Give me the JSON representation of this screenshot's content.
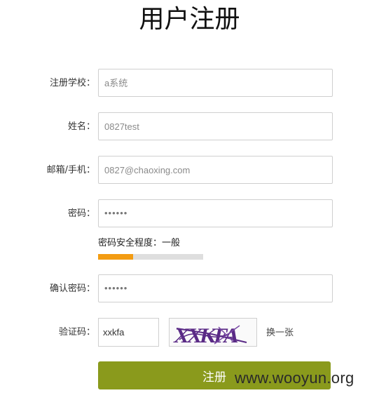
{
  "page": {
    "title": "用户注册"
  },
  "form": {
    "school": {
      "label": "注册学校：",
      "placeholder": "a系统"
    },
    "name": {
      "label": "姓名：",
      "placeholder": "0827test"
    },
    "contact": {
      "label": "邮箱/手机：",
      "placeholder": "0827@chaoxing.com"
    },
    "password": {
      "label": "密码：",
      "value": "••••••"
    },
    "strength": {
      "text": "密码安全程度：一般",
      "level": 0.33,
      "color": "#f39c12"
    },
    "confirm": {
      "label": "确认密码：",
      "value": "••••••"
    },
    "captcha": {
      "label": "验证码：",
      "value": "xxkfa",
      "image_text": "XXKFA",
      "refresh_label": "换一张"
    },
    "submit_label": "注册"
  },
  "colors": {
    "submit": "#8a9a1c",
    "strength": "#f39c12"
  },
  "watermark": "www.wooyun.org"
}
